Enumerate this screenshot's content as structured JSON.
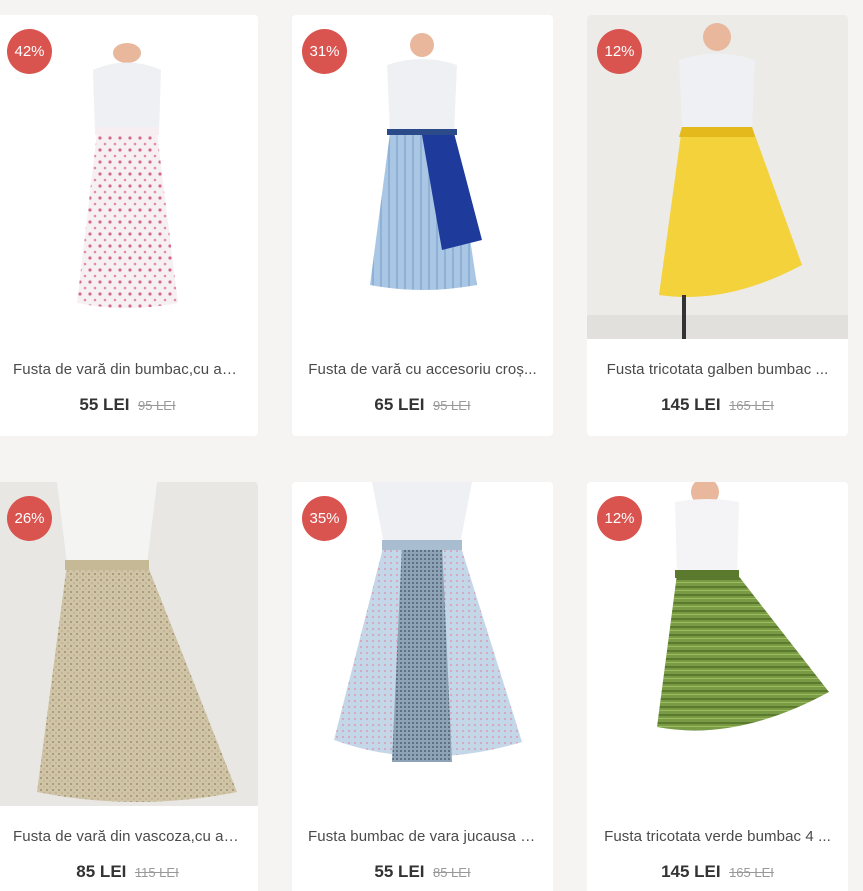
{
  "products": [
    {
      "discount": "42%",
      "title": "Fusta de vară din bumbac,cu ac...",
      "price": "55 LEI",
      "old_price": "95 LEI",
      "colors": {
        "skirt": "#f4eef0",
        "pattern": "#d87a95",
        "top": "#eef0f3",
        "bg": "#ffffff"
      }
    },
    {
      "discount": "31%",
      "title": "Fusta de vară cu accesoriu croș...",
      "price": "65 LEI",
      "old_price": "95 LEI",
      "colors": {
        "skirt": "#a9c6e4",
        "pattern": "#1e3a9b",
        "top": "#eef0f3",
        "bg": "#ffffff"
      }
    },
    {
      "discount": "12%",
      "title": "Fusta tricotata galben bumbac ...",
      "price": "145 LEI",
      "old_price": "165 LEI",
      "colors": {
        "skirt": "#f3d23c",
        "pattern": "#e3b91c",
        "top": "#eef0f3",
        "bg": "#ecebe8"
      }
    },
    {
      "discount": "26%",
      "title": "Fusta de vară din vascoza,cu ac...",
      "price": "85 LEI",
      "old_price": "115 LEI",
      "colors": {
        "skirt": "#cfc4a6",
        "pattern": "#9d8c6a",
        "top": "#eef0f3",
        "bg": "#e9e7e4"
      }
    },
    {
      "discount": "35%",
      "title": "Fusta bumbac de vara jucausa c...",
      "price": "55 LEI",
      "old_price": "85 LEI",
      "colors": {
        "skirt": "#c4d7e8",
        "pattern": "#6f8294",
        "top": "#eef0f3",
        "bg": "#ffffff"
      }
    },
    {
      "discount": "12%",
      "title": "Fusta tricotata verde bumbac 4 ...",
      "price": "145 LEI",
      "old_price": "165 LEI",
      "colors": {
        "skirt": "#7a9b45",
        "pattern": "#5c7a2e",
        "top": "#f4f3f6",
        "bg": "#ffffff"
      }
    }
  ]
}
